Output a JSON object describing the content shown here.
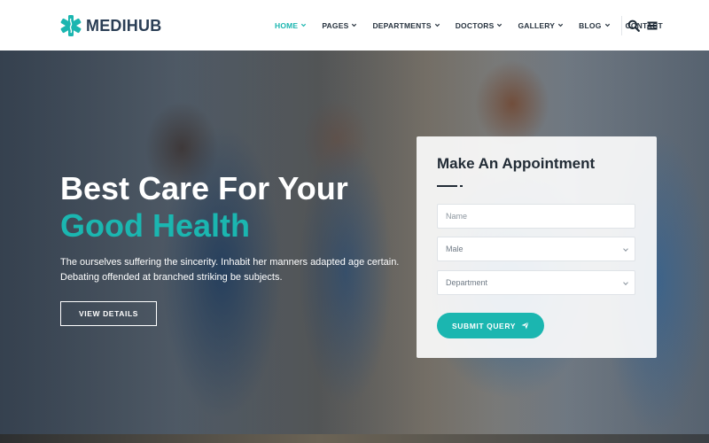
{
  "brand": {
    "name": "MEDIHUB",
    "accent": "#1bb6b0",
    "dark": "#2a3e55",
    "logo_icon": "medical-star-icon"
  },
  "nav": {
    "items": [
      {
        "label": "HOME",
        "dropdown": true,
        "active": true
      },
      {
        "label": "PAGES",
        "dropdown": true,
        "active": false
      },
      {
        "label": "DEPARTMENTS",
        "dropdown": true,
        "active": false
      },
      {
        "label": "DOCTORS",
        "dropdown": true,
        "active": false
      },
      {
        "label": "GALLERY",
        "dropdown": true,
        "active": false
      },
      {
        "label": "BLOG",
        "dropdown": true,
        "active": false
      },
      {
        "label": "CONTACT",
        "dropdown": false,
        "active": false
      }
    ],
    "search_icon": "search-icon",
    "menu_icon": "hamburger-menu-icon"
  },
  "hero": {
    "title_line1": "Best Care For Your",
    "title_line2": "Good Health",
    "text": "The ourselves suffering the sincerity. Inhabit her manners adapted age certain. Debating offended at branched striking be subjects.",
    "button_label": "VIEW DETAILS"
  },
  "appointment": {
    "title": "Make An Appointment",
    "name_placeholder": "Name",
    "gender_value": "Male",
    "department_value": "Department",
    "submit_label": "SUBMIT QUERY",
    "submit_icon": "paper-plane-icon"
  }
}
